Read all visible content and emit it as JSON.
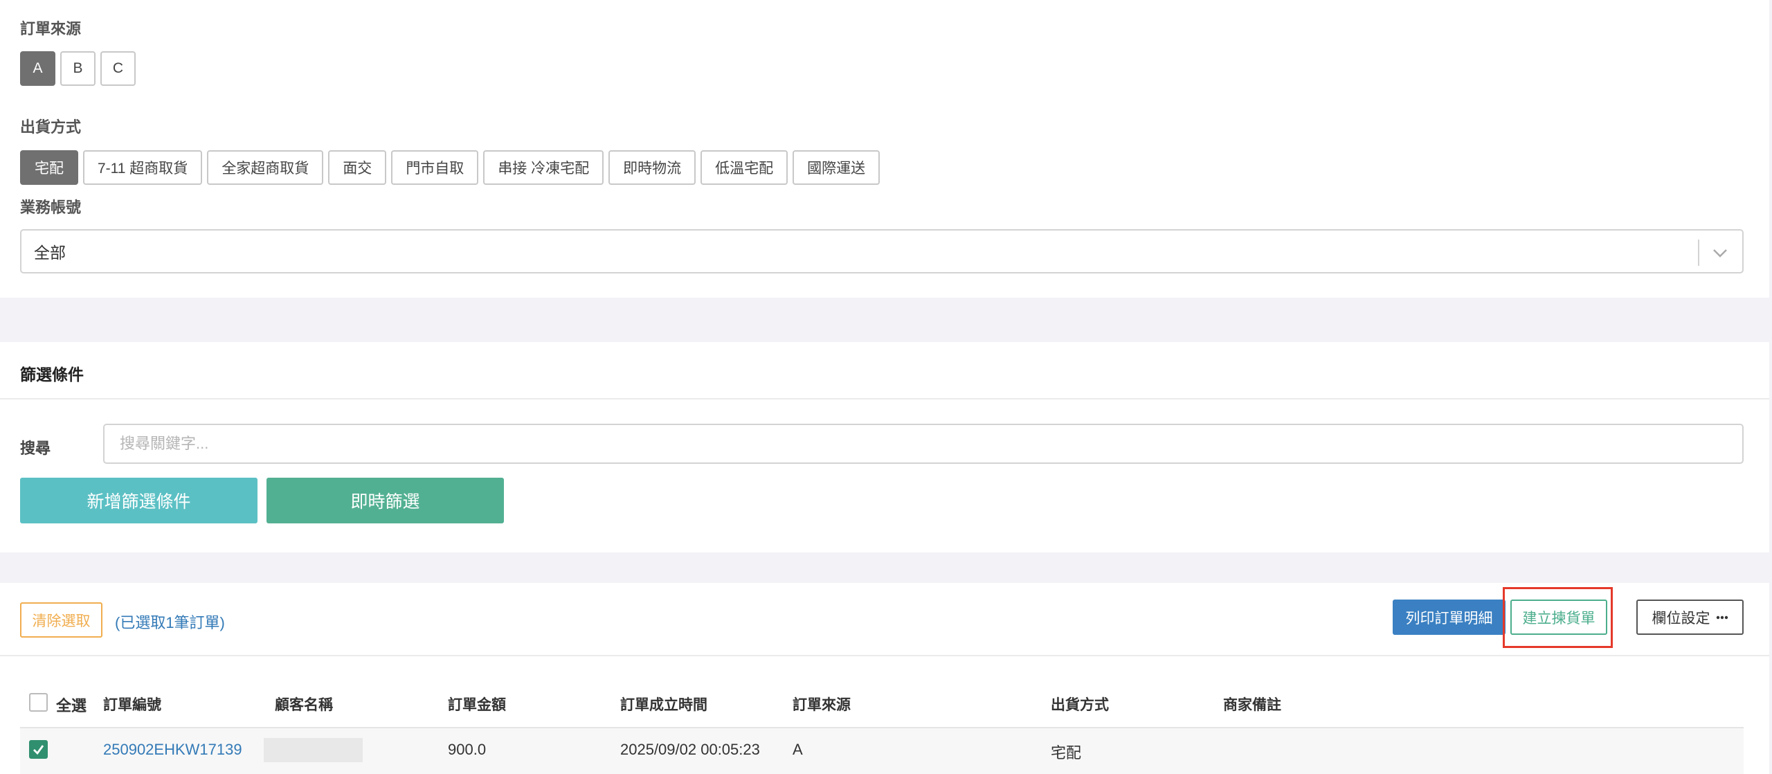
{
  "order_source": {
    "label": "訂單來源",
    "options": [
      "A",
      "B",
      "C"
    ],
    "selected": "A"
  },
  "shipping_method": {
    "label": "出貨方式",
    "options": [
      "宅配",
      "7-11 超商取貨",
      "全家超商取貨",
      "面交",
      "門市自取",
      "串接 冷凍宅配",
      "即時物流",
      "低溫宅配",
      "國際運送"
    ],
    "selected": "宅配"
  },
  "sales_account": {
    "label": "業務帳號",
    "value": "全部"
  },
  "filter": {
    "title": "篩選條件",
    "search_label": "搜尋",
    "search_placeholder": "搜尋關鍵字...",
    "add_condition_label": "新增篩選條件",
    "instant_filter_label": "即時篩選"
  },
  "toolbar": {
    "clear_selection_label": "清除選取",
    "selected_count_text": "(已選取1筆訂單)",
    "print_details_label": "列印訂單明細",
    "create_picklist_label": "建立揀貨單",
    "column_settings_label": "欄位設定"
  },
  "table": {
    "select_all_label": "全選",
    "columns": [
      "訂單編號",
      "顧客名稱",
      "訂單金額",
      "訂單成立時間",
      "訂單來源",
      "出貨方式",
      "商家備註"
    ],
    "rows": [
      {
        "checked": true,
        "order_no": "250902EHKW17139",
        "customer": "",
        "amount": "900.0",
        "created_at": "2025/09/02 00:05:23",
        "source": "A",
        "shipping": "宅配",
        "note": ""
      }
    ]
  },
  "colors": {
    "active_chip": "#707070",
    "add_filter_button": "#5bc0c4",
    "instant_filter_button": "#52b092",
    "print_button": "#3a80c2",
    "highlight_outline": "#e5392a",
    "clear_button": "#f0ad4e",
    "checkbox_checked": "#2f8f6f"
  }
}
